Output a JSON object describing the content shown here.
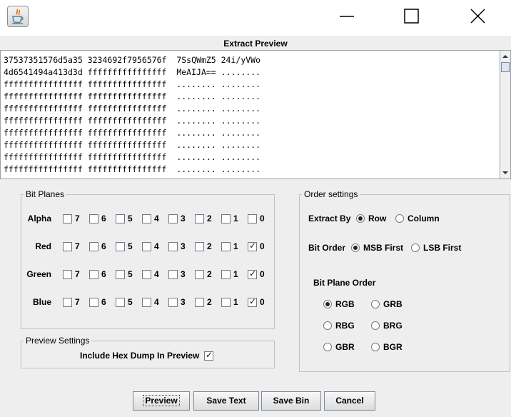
{
  "extract_preview": {
    "label": "Extract Preview",
    "lines": [
      "37537351576d5a35 3234692f7956576f  7SsQWmZ5 24i/yVWo",
      "4d6541494a413d3d ffffffffffffffff  MeAIJA== ........",
      "ffffffffffffffff ffffffffffffffff  ........ ........",
      "ffffffffffffffff ffffffffffffffff  ........ ........",
      "ffffffffffffffff ffffffffffffffff  ........ ........",
      "ffffffffffffffff ffffffffffffffff  ........ ........",
      "ffffffffffffffff ffffffffffffffff  ........ ........",
      "ffffffffffffffff ffffffffffffffff  ........ ........",
      "ffffffffffffffff ffffffffffffffff  ........ ........",
      "ffffffffffffffff ffffffffffffffff  ........ ........"
    ]
  },
  "bit_planes": {
    "title": "Bit Planes",
    "bits": [
      "7",
      "6",
      "5",
      "4",
      "3",
      "2",
      "1",
      "0"
    ],
    "channels": [
      {
        "name": "Alpha",
        "checked": [
          false,
          false,
          false,
          false,
          false,
          false,
          false,
          false
        ]
      },
      {
        "name": "Red",
        "checked": [
          false,
          false,
          false,
          false,
          false,
          false,
          false,
          true
        ]
      },
      {
        "name": "Green",
        "checked": [
          false,
          false,
          false,
          false,
          false,
          false,
          false,
          true
        ]
      },
      {
        "name": "Blue",
        "checked": [
          false,
          false,
          false,
          false,
          false,
          false,
          false,
          true
        ]
      }
    ]
  },
  "preview_settings": {
    "title": "Preview Settings",
    "hex_dump_label": "Include Hex Dump In Preview",
    "hex_dump_checked": true
  },
  "order_settings": {
    "title": "Order settings",
    "extract_by": {
      "label": "Extract By",
      "options": [
        "Row",
        "Column"
      ],
      "selected": "Row"
    },
    "bit_order": {
      "label": "Bit Order",
      "options": [
        "MSB First",
        "LSB First"
      ],
      "selected": "MSB First"
    },
    "bit_plane_order": {
      "label": "Bit Plane Order",
      "options": [
        "RGB",
        "GRB",
        "RBG",
        "BRG",
        "GBR",
        "BGR"
      ],
      "selected": "RGB"
    }
  },
  "buttons": {
    "preview": "Preview",
    "save_text": "Save Text",
    "save_bin": "Save Bin",
    "cancel": "Cancel"
  }
}
